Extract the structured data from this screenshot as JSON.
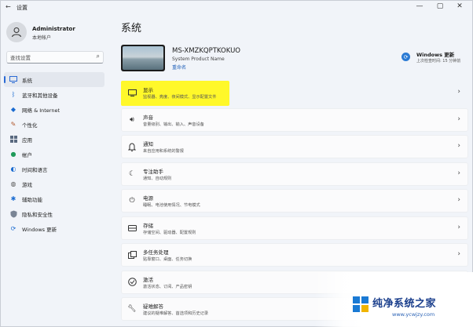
{
  "window": {
    "title": "设置",
    "controls": {
      "minimize": "—",
      "maximize": "▢",
      "close": "✕"
    }
  },
  "profile": {
    "name": "Administrator",
    "account_type": "本地帐户"
  },
  "search": {
    "placeholder": "查找设置"
  },
  "sidebar": {
    "items": [
      {
        "label": "系统",
        "icon": "display-icon",
        "active": true
      },
      {
        "label": "蓝牙和其他设备",
        "icon": "bluetooth-icon"
      },
      {
        "label": "网络 & Internet",
        "icon": "network-icon"
      },
      {
        "label": "个性化",
        "icon": "brush-icon"
      },
      {
        "label": "应用",
        "icon": "apps-icon"
      },
      {
        "label": "帐户",
        "icon": "person-icon"
      },
      {
        "label": "时间和语言",
        "icon": "globe-icon"
      },
      {
        "label": "游戏",
        "icon": "gamepad-icon"
      },
      {
        "label": "辅助功能",
        "icon": "accessibility-icon"
      },
      {
        "label": "隐私和安全性",
        "icon": "shield-icon"
      },
      {
        "label": "Windows 更新",
        "icon": "update-icon"
      }
    ]
  },
  "main": {
    "title": "系统",
    "device": {
      "name": "MS-XMZKQPTKOKUO",
      "model": "System Product Name",
      "rename": "重命名"
    },
    "windows_update": {
      "title": "Windows 更新",
      "subtitle": "上次检查时间: 15 分钟前"
    },
    "settings": [
      {
        "title": "显示",
        "desc": "监视器、亮度、夜间模式、显示配置文件",
        "icon": "monitor-icon",
        "highlighted": true
      },
      {
        "title": "声音",
        "desc": "音量级别、输出、输入、声音设备",
        "icon": "speaker-icon"
      },
      {
        "title": "通知",
        "desc": "来自应用和系统的警报",
        "icon": "bell-icon"
      },
      {
        "title": "专注助手",
        "desc": "通知、自动规则",
        "icon": "moon-icon"
      },
      {
        "title": "电源",
        "desc": "睡眠、电池使用情况、节电模式",
        "icon": "power-icon"
      },
      {
        "title": "存储",
        "desc": "存储空间、驱动器、配置规则",
        "icon": "storage-icon"
      },
      {
        "title": "多任务处理",
        "desc": "贴靠窗口、桌面、任务切换",
        "icon": "multitask-icon"
      },
      {
        "title": "激活",
        "desc": "激活状态、订阅、产品密钥",
        "icon": "check-circle-icon"
      },
      {
        "title": "疑难解答",
        "desc": "建议的疑难解答、首选项和历史记录",
        "icon": "wrench-icon"
      }
    ]
  },
  "watermark": {
    "brand": "纯净系统之家",
    "url": "www.ycwjzy.com"
  },
  "colors": {
    "accent": "#2a6ad4",
    "highlight": "#fff82a",
    "watermark": "#1a3e8c"
  }
}
